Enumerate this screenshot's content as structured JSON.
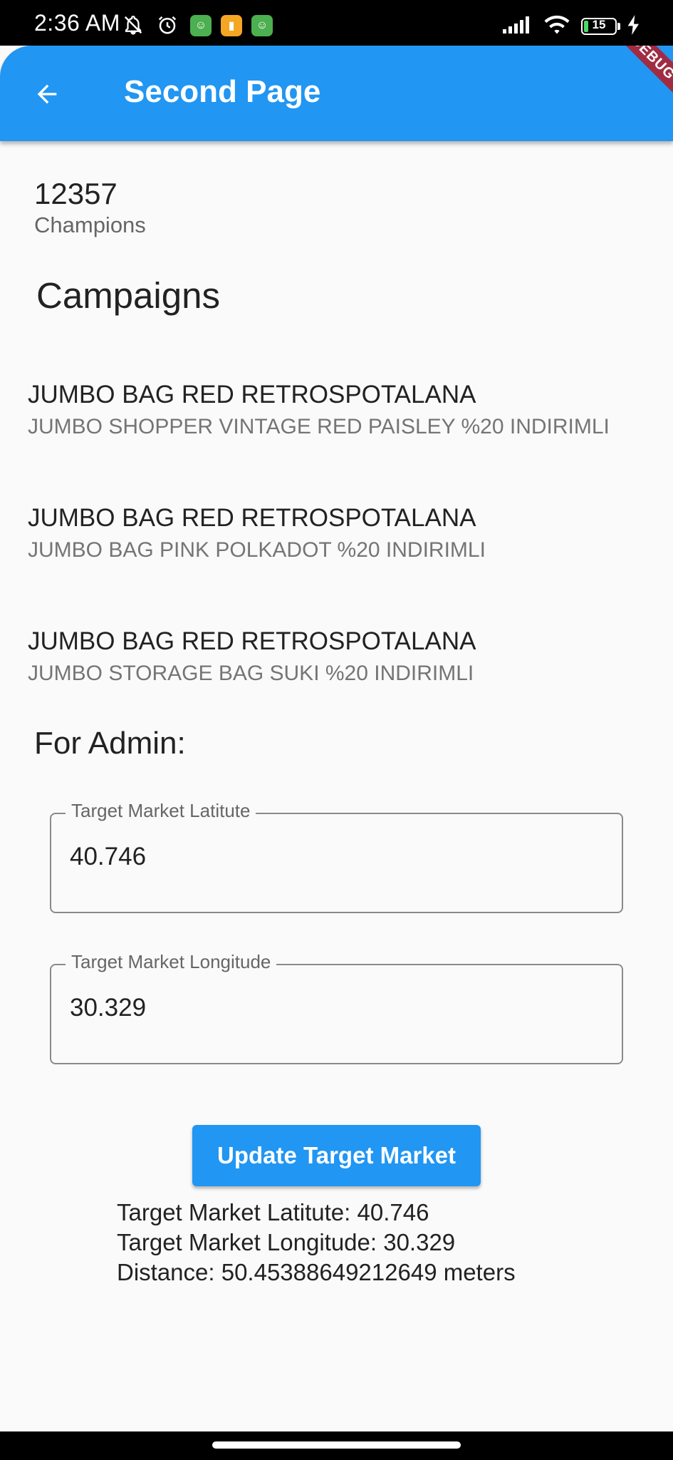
{
  "status_bar": {
    "time": "2:36 AM",
    "battery_level": "15",
    "battery_percent": 15
  },
  "app_bar": {
    "title": "Second Page",
    "debug_banner": "DEBUG",
    "color": "#2196f3"
  },
  "score": {
    "value": "12357",
    "label": "Champions"
  },
  "campaigns": {
    "heading": "Campaigns",
    "items": [
      {
        "title": "JUMBO BAG RED RETROSPOTALANA",
        "subtitle": "JUMBO SHOPPER VINTAGE RED PAISLEY %20 INDIRIMLI"
      },
      {
        "title": "JUMBO BAG RED RETROSPOTALANA",
        "subtitle": "JUMBO BAG PINK POLKADOT %20 INDIRIMLI"
      },
      {
        "title": "JUMBO BAG RED RETROSPOTALANA",
        "subtitle": "JUMBO STORAGE BAG SUKI %20 INDIRIMLI"
      }
    ]
  },
  "admin": {
    "heading": "For Admin:",
    "latitude_field": {
      "label": "Target Market Latitute",
      "value": "40.746"
    },
    "longitude_field": {
      "label": "Target Market Longitude",
      "value": "30.329"
    },
    "update_button": "Update Target Market",
    "results": {
      "latitude": "Target Market Latitute: 40.746",
      "longitude": "Target Market Longitude: 30.329",
      "distance": "Distance: 50.45388649212649 meters"
    }
  }
}
